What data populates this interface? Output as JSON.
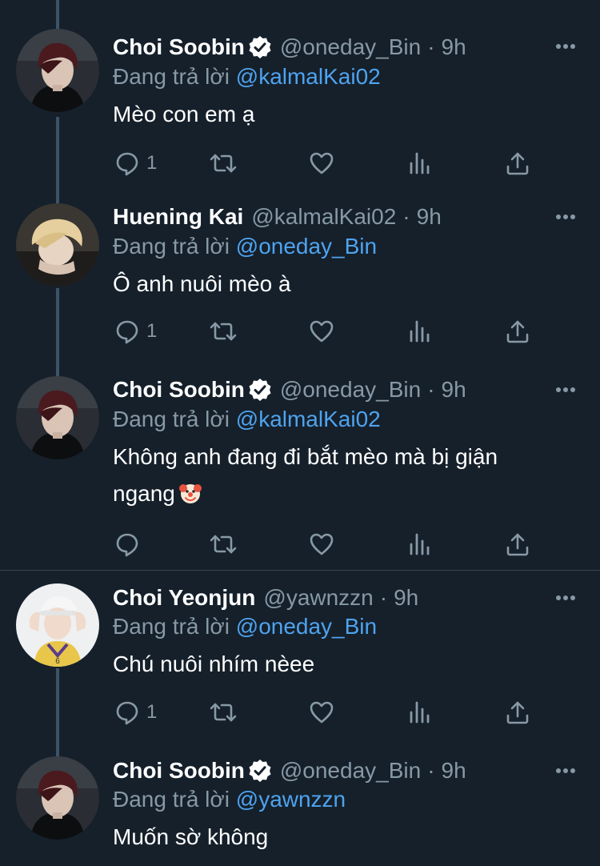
{
  "colors": {
    "background": "#15202b",
    "secondary_text": "#8899a6",
    "mention": "#4fa3ee",
    "thread_line": "#3d5466",
    "divider": "#38444d"
  },
  "reply_prefix": "Đang trả lời",
  "tweets": [
    {
      "name": "Choi Soobin",
      "verified": true,
      "handle": "@oneday_Bin",
      "separator": "·",
      "time": "9h",
      "reply_to": "@kalmalKai02",
      "text": "Mèo con em ạ",
      "reply_count": "1",
      "icons": [
        "reply-icon",
        "retweet-icon",
        "like-icon",
        "analytics-icon",
        "share-icon"
      ]
    },
    {
      "name": "Huening Kai",
      "verified": false,
      "handle": "@kalmalKai02",
      "separator": "·",
      "time": "9h",
      "reply_to": "@oneday_Bin",
      "text": "Ô anh nuôi mèo à",
      "reply_count": "1",
      "icons": [
        "reply-icon",
        "retweet-icon",
        "like-icon",
        "analytics-icon",
        "share-icon"
      ]
    },
    {
      "name": "Choi Soobin",
      "verified": true,
      "handle": "@oneday_Bin",
      "separator": "·",
      "time": "9h",
      "reply_to": "@kalmalKai02",
      "text_line1": "Không anh đang đi bắt mèo mà bị giận",
      "text_line2": "ngang",
      "emoji": "clown-face-emoji",
      "reply_count": "",
      "icons": [
        "reply-icon",
        "retweet-icon",
        "like-icon",
        "analytics-icon",
        "share-icon"
      ]
    },
    {
      "name": "Choi Yeonjun",
      "verified": false,
      "handle": "@yawnzzn",
      "separator": "·",
      "time": "9h",
      "reply_to": "@oneday_Bin",
      "text": "Chú nuôi nhím nèee",
      "reply_count": "1",
      "icons": [
        "reply-icon",
        "retweet-icon",
        "like-icon",
        "analytics-icon",
        "share-icon"
      ]
    },
    {
      "name": "Choi Soobin",
      "verified": true,
      "handle": "@oneday_Bin",
      "separator": "·",
      "time": "9h",
      "reply_to": "@yawnzzn",
      "text": "Muốn sờ không"
    }
  ]
}
